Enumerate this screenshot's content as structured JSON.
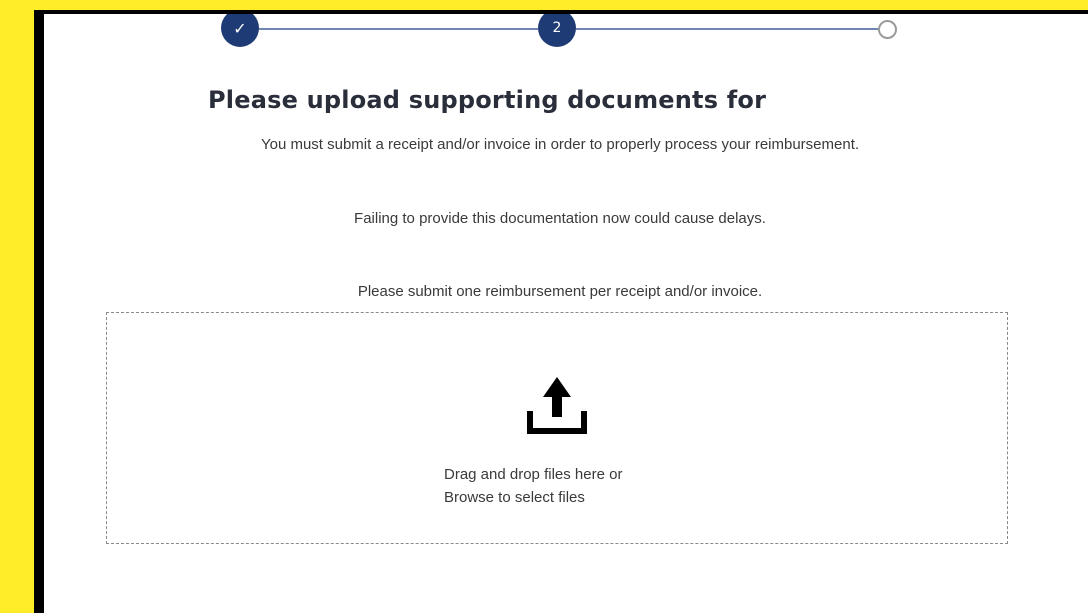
{
  "stepper": {
    "step1_symbol": "✓",
    "step2_number": "2"
  },
  "heading": "Please upload supporting documents for",
  "instructions": [
    "You must submit a receipt and/or invoice in order to properly process your reimbursement.",
    "Failing to provide this documentation now could cause delays.",
    "Please submit one reimbursement per receipt and/or invoice."
  ],
  "dropzone": {
    "line1": "Drag and drop files here or",
    "line2": "Browse to select files"
  },
  "colors": {
    "background": "#ffed29",
    "step_active": "#1f3b75"
  }
}
